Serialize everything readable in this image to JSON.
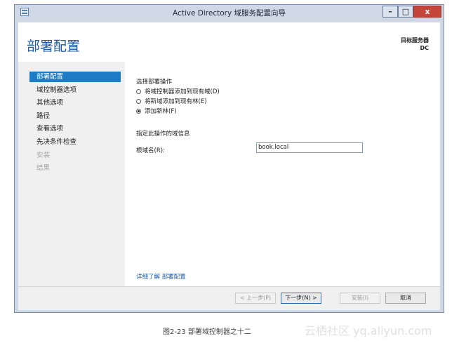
{
  "window": {
    "title": "Active Directory 域服务配置向导"
  },
  "header": {
    "page_title": "部署配置",
    "target_label": "目标服务器",
    "target_value": "DC"
  },
  "nav": {
    "items": [
      {
        "label": "部署配置",
        "state": "active"
      },
      {
        "label": "域控制器选项",
        "state": "normal"
      },
      {
        "label": "其他选项",
        "state": "normal"
      },
      {
        "label": "路径",
        "state": "normal"
      },
      {
        "label": "查看选项",
        "state": "normal"
      },
      {
        "label": "先决条件检查",
        "state": "normal"
      },
      {
        "label": "安装",
        "state": "disabled"
      },
      {
        "label": "结果",
        "state": "disabled"
      }
    ]
  },
  "content": {
    "operation_title": "选择部署操作",
    "options": [
      {
        "label": "将域控制器添加到现有域(D)",
        "checked": false
      },
      {
        "label": "将新域添加到现有林(E)",
        "checked": false
      },
      {
        "label": "添加新林(F)",
        "checked": true
      }
    ],
    "domain_info_title": "指定此操作的域信息",
    "root_domain_label": "根域名(R):",
    "root_domain_value": "book.local",
    "learn_more": "详细了解 部署配置"
  },
  "footer": {
    "prev": "< 上一步(P)",
    "next": "下一步(N) >",
    "install": "安装(I)",
    "cancel": "取消"
  },
  "caption": "图2-23    部署域控制器之十二",
  "watermark": "云栖社区 yq.aliyun.com"
}
